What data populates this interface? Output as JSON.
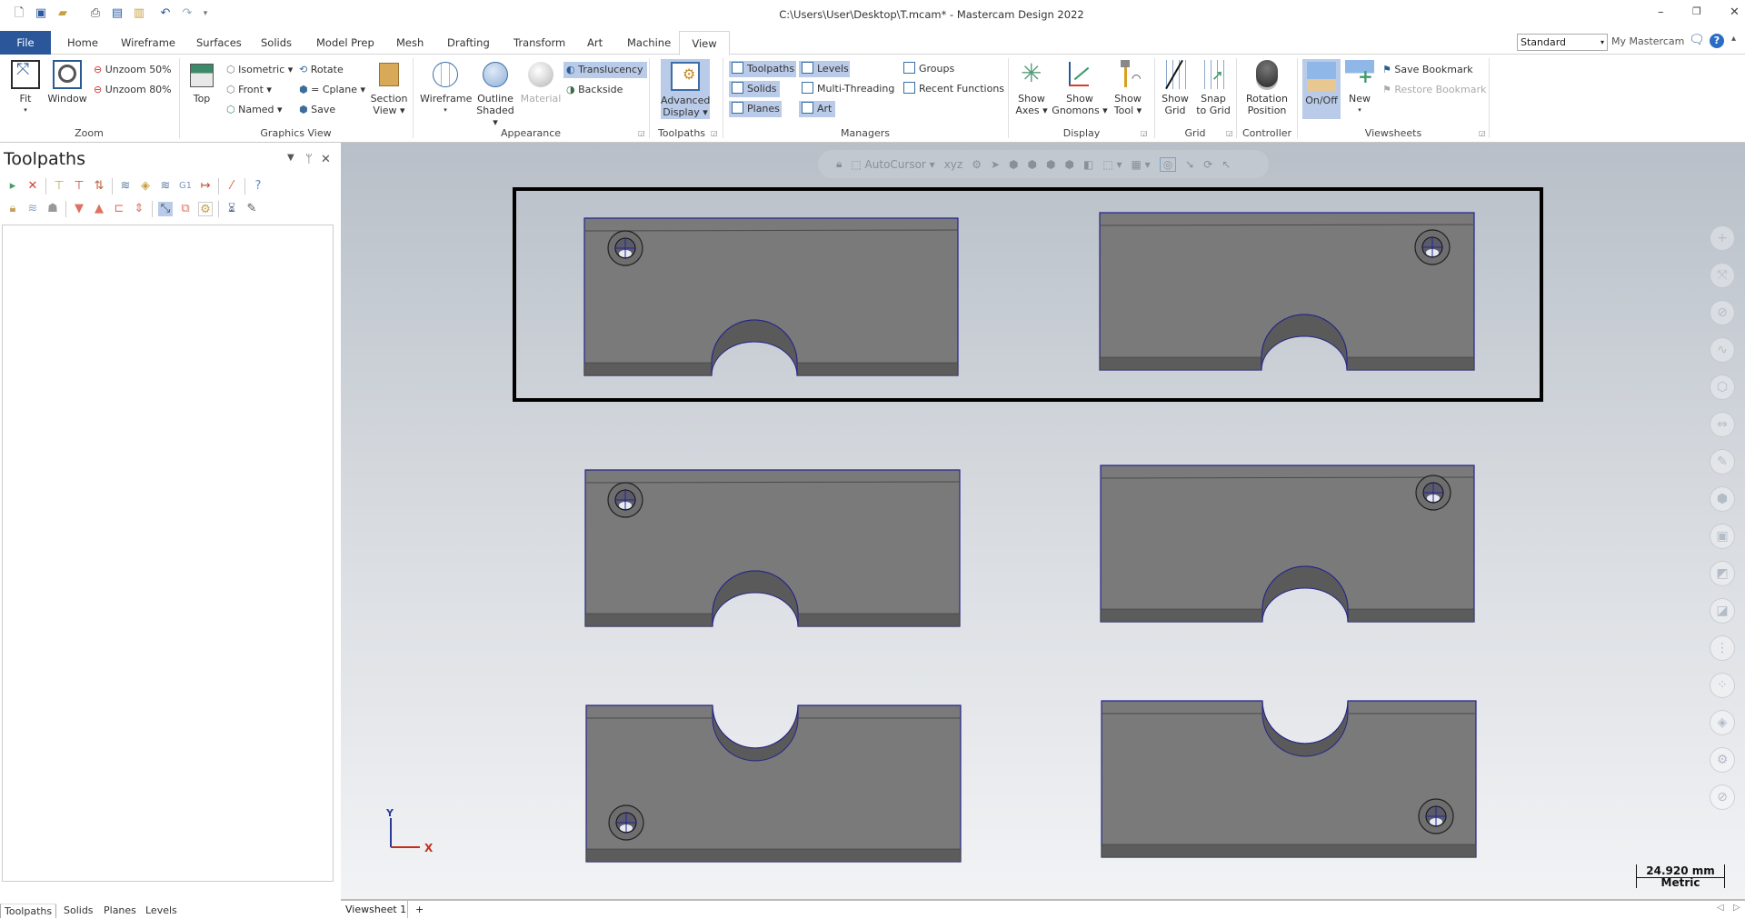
{
  "window": {
    "title": "C:\\Users\\User\\Desktop\\T.mcam* - Mastercam Design 2022",
    "controls": [
      "minimize-icon",
      "restore-icon",
      "close-icon"
    ]
  },
  "quick_access": [
    "new-file-icon",
    "save-icon",
    "open-icon",
    "print-icon",
    "save-as-icon",
    "toolbox-icon",
    "undo-icon",
    "redo-icon",
    "customize-icon"
  ],
  "tabs": [
    "File",
    "Home",
    "Wireframe",
    "Surfaces",
    "Solids",
    "Model Prep",
    "Mesh",
    "Drafting",
    "Transform",
    "Art",
    "Machine",
    "View"
  ],
  "active_tab": "View",
  "workspace": {
    "selected": "Standard",
    "my_mastercam": "My Mastercam"
  },
  "ribbon": {
    "zoom": {
      "label": "Zoom",
      "fit": "Fit",
      "window": "Window",
      "unzoom50": "Unzoom 50%",
      "unzoom80": "Unzoom 80%"
    },
    "graphics_view": {
      "label": "Graphics View",
      "top": "Top",
      "isometric": "Isometric",
      "front": "Front",
      "named": "Named",
      "rotate": "Rotate",
      "cplane": "= Cplane",
      "save": "Save",
      "section_view_1": "Section",
      "section_view_2": "View"
    },
    "appearance": {
      "label": "Appearance",
      "wireframe": "Wireframe",
      "outline_1": "Outline",
      "outline_2": "Shaded",
      "material": "Material",
      "translucency": "Translucency",
      "backside": "Backside"
    },
    "toolpaths": {
      "label": "Toolpaths",
      "advanced_1": "Advanced",
      "advanced_2": "Display"
    },
    "managers": {
      "label": "Managers",
      "toolpaths": "Toolpaths",
      "solids": "Solids",
      "planes": "Planes",
      "levels": "Levels",
      "multithreading": "Multi-Threading",
      "art": "Art",
      "groups": "Groups",
      "recent": "Recent Functions"
    },
    "display": {
      "label": "Display",
      "axes_1": "Show",
      "axes_2": "Axes",
      "gnomons_1": "Show",
      "gnomons_2": "Gnomons",
      "tool_1": "Show",
      "tool_2": "Tool"
    },
    "grid": {
      "label": "Grid",
      "show_1": "Show",
      "show_2": "Grid",
      "snap_1": "Snap",
      "snap_2": "to Grid"
    },
    "controller": {
      "label": "Controller",
      "rot_1": "Rotation",
      "rot_2": "Position"
    },
    "viewsheets": {
      "label": "Viewsheets",
      "onoff": "On/Off",
      "new": "New",
      "save_bookmark": "Save Bookmark",
      "restore_bookmark": "Restore Bookmark"
    }
  },
  "panel": {
    "title": "Toolpaths",
    "bottom_tabs": [
      "Toolpaths",
      "Solids",
      "Planes",
      "Levels"
    ],
    "active_bottom_tab": "Toolpaths",
    "g1_label": "G1"
  },
  "viewport": {
    "autocursor": "AutoCursor",
    "xyz": "xyz",
    "axis_x": "X",
    "axis_y": "Y",
    "scale_value": "24.920 mm",
    "scale_units": "Metric",
    "viewsheet_tab": "Viewsheet 1",
    "add_viewsheet": "+"
  },
  "colors": {
    "accent": "#2b579a",
    "highlight": "#b9cbe8",
    "part_face": "#7a7a7a",
    "part_edge": "#25258a",
    "selection_box": "#000000"
  }
}
